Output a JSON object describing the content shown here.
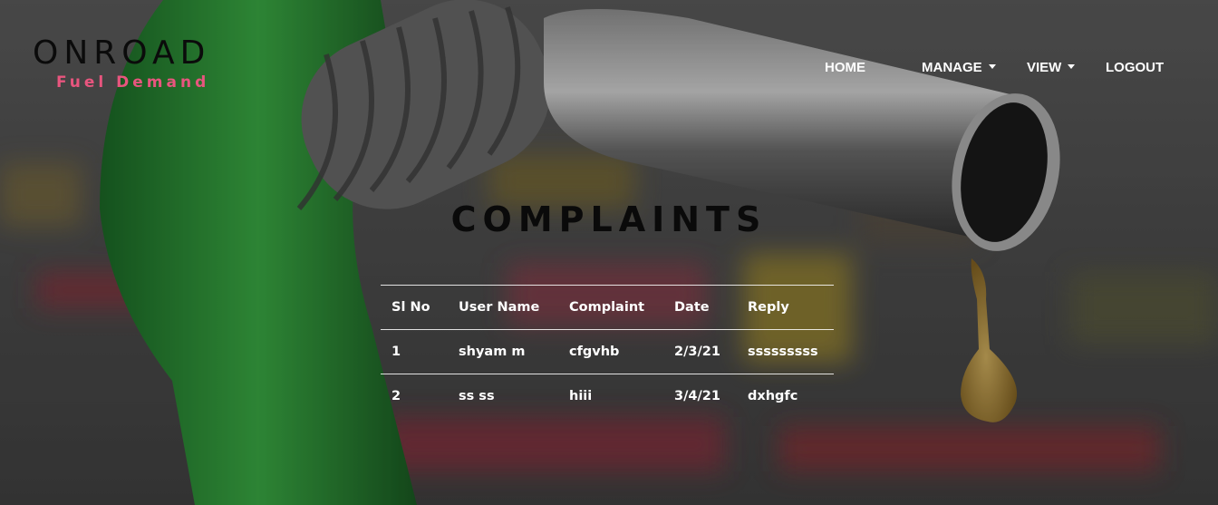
{
  "brand": {
    "title": "ONROAD",
    "subtitle": "Fuel Demand"
  },
  "nav": {
    "home": "HOME",
    "manage": "MANAGE",
    "view": "VIEW",
    "logout": "LOGOUT"
  },
  "page": {
    "title": "COMPLAINTS"
  },
  "table": {
    "headers": [
      "Sl No",
      "User Name",
      "Complaint",
      "Date",
      "Reply"
    ],
    "rows": [
      [
        "1",
        "shyam m",
        "cfgvhb",
        "2/3/21",
        "sssssssss"
      ],
      [
        "2",
        "ss ss",
        "hiii",
        "3/4/21",
        "dxhgfc"
      ]
    ]
  },
  "colors": {
    "nozzle_green": "#1f8f2e",
    "brand_pink": "#e8557e",
    "text_white": "#ffffff"
  }
}
